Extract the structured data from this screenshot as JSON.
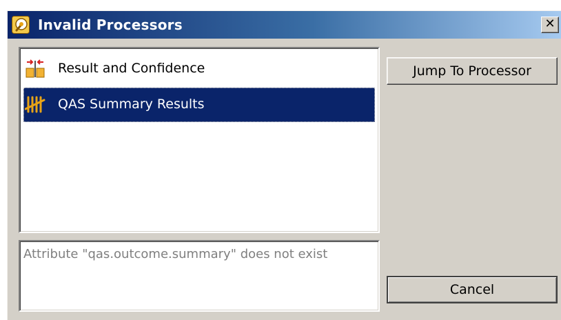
{
  "window": {
    "title": "Invalid Processors",
    "title_icon": "processor-badge-icon",
    "close_label": "✕"
  },
  "processor_list": {
    "items": [
      {
        "label": "Result and Confidence",
        "icon": "result-confidence-icon",
        "selected": false
      },
      {
        "label": "QAS Summary Results",
        "icon": "tally-marks-icon",
        "selected": true
      }
    ]
  },
  "details": {
    "message": "Attribute \"qas.outcome.summary\" does not exist"
  },
  "buttons": {
    "jump_label": "Jump To Processor",
    "cancel_label": "Cancel"
  },
  "colors": {
    "title_bar_start": "#0a246a",
    "title_bar_end": "#a6caf0",
    "selection": "#0a246a",
    "dialog_face": "#d4d0c8",
    "icon_gold": "#e8a317",
    "icon_red": "#d62020"
  }
}
